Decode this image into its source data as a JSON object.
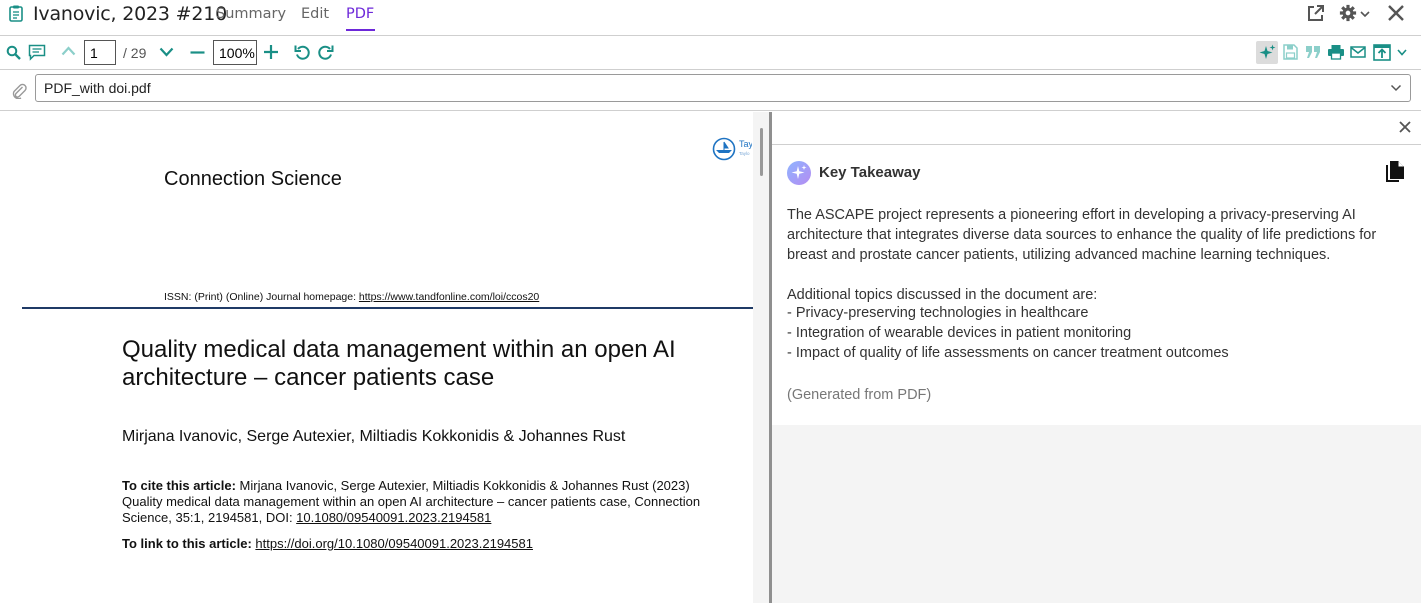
{
  "window": {
    "title": "Ivanovic, 2023 #210",
    "tabs": [
      {
        "label": "Summary",
        "active": false
      },
      {
        "label": "Edit",
        "active": false
      },
      {
        "label": "PDF",
        "active": true
      }
    ],
    "accent_color": "#6d28d9",
    "teal_color": "#1a8f86"
  },
  "toolbar": {
    "page_current": "1",
    "page_total": "/ 29",
    "zoom": "100%"
  },
  "attachment": {
    "file_name": "PDF_with doi.pdf"
  },
  "pdf": {
    "journal_logo_text": "Tay",
    "journal_name": "Connection Science",
    "issn_prefix": "ISSN: (Print) (Online) Journal homepage: ",
    "issn_url": "https://www.tandfonline.com/loi/ccos20",
    "article_title": "Quality medical data management within an open AI architecture – cancer patients case",
    "authors": "Mirjana Ivanovic, Serge Autexier, Miltiadis Kokkonidis & Johannes Rust",
    "cite_label": "To cite this article:",
    "cite_text": " Mirjana Ivanovic, Serge Autexier, Miltiadis Kokkonidis & Johannes Rust (2023) Quality medical data management within an open AI architecture – cancer patients case, Connection Science, 35:1, 2194581, DOI: ",
    "cite_doi": "10.1080/09540091.2023.2194581",
    "link_label": "To link to this article: ",
    "link_url": "https://doi.org/10.1080/09540091.2023.2194581"
  },
  "side_panel": {
    "title": "Key Takeaway",
    "summary": "The ASCAPE project represents a pioneering effort in developing a privacy-preserving AI architecture that integrates diverse data sources to enhance the quality of life predictions for breast and prostate cancer patients, utilizing advanced machine learning techniques.",
    "topics_intro": "Additional topics discussed in the document are:",
    "topics": [
      "- Privacy-preserving technologies in healthcare",
      "- Integration of wearable devices in patient monitoring",
      "- Impact of quality of life assessments on cancer treatment outcomes"
    ],
    "generated_note": "(Generated from PDF)"
  },
  "icons": [
    "clipboard-icon",
    "external-link-icon",
    "gear-icon",
    "close-icon",
    "search-icon",
    "comment-icon",
    "chevron-up-icon",
    "chevron-down-icon",
    "zoom-out-icon",
    "zoom-in-icon",
    "rotate-left-icon",
    "rotate-right-icon",
    "ai-sparkle-icon",
    "save-icon",
    "quote-icon",
    "print-icon",
    "email-icon",
    "export-icon",
    "paperclip-icon",
    "copy-icon"
  ]
}
